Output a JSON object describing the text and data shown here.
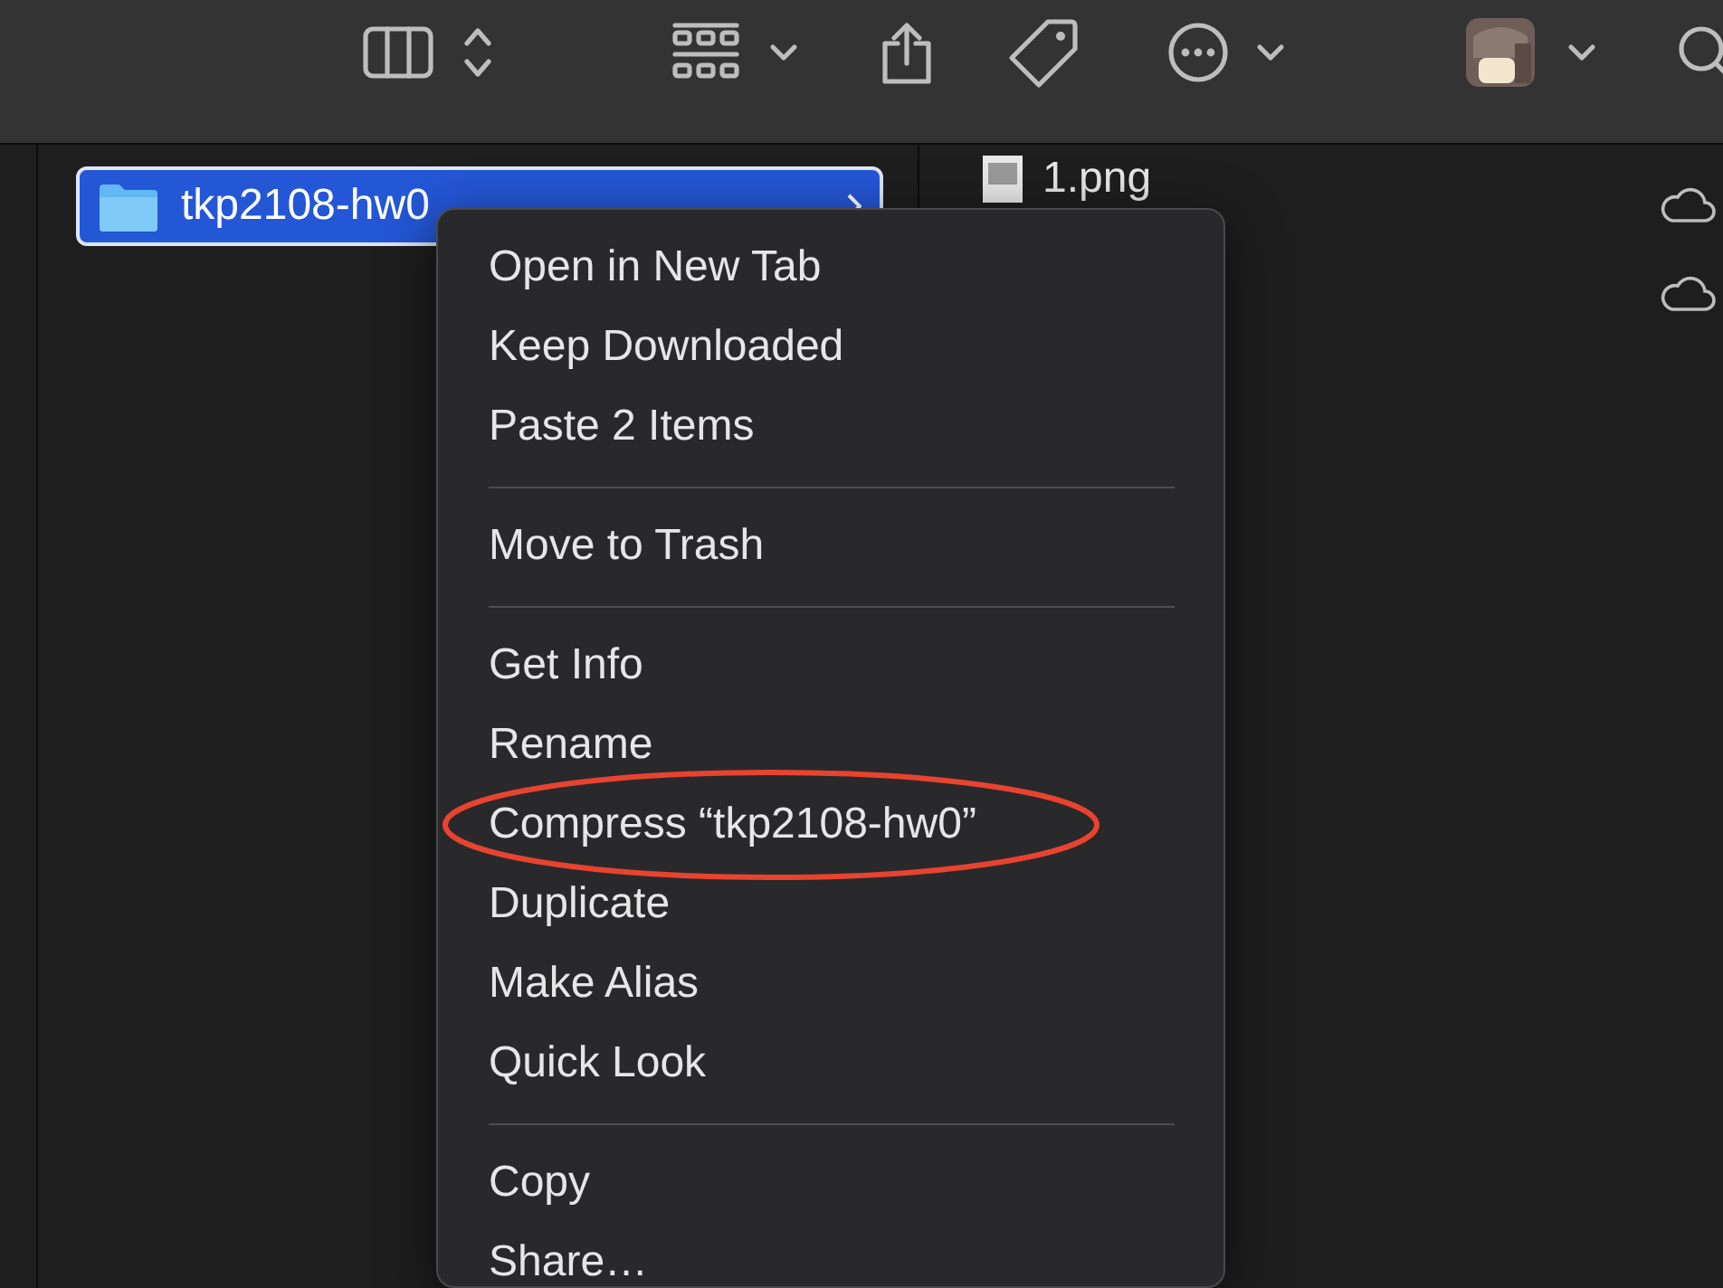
{
  "toolbar": {
    "buttons": [
      {
        "kind": "columns"
      },
      {
        "kind": "updown"
      },
      {
        "kind": "grid"
      },
      {
        "kind": "chevron"
      },
      {
        "kind": "share"
      },
      {
        "kind": "tag"
      },
      {
        "kind": "more"
      },
      {
        "kind": "chevron"
      },
      {
        "kind": "avatar"
      },
      {
        "kind": "chevron"
      },
      {
        "kind": "search"
      }
    ]
  },
  "folder": {
    "name": "tkp2108-hw0",
    "selected": true
  },
  "files": [
    {
      "name": "1.png"
    }
  ],
  "context_menu": {
    "items": [
      {
        "kind": "item",
        "label": "Open in New Tab",
        "circled": false
      },
      {
        "kind": "item",
        "label": "Keep Downloaded",
        "circled": false
      },
      {
        "kind": "item",
        "label": "Paste 2 Items",
        "circled": false
      },
      {
        "kind": "separator"
      },
      {
        "kind": "item",
        "label": "Move to Trash",
        "circled": false
      },
      {
        "kind": "separator"
      },
      {
        "kind": "item",
        "label": "Get Info",
        "circled": false
      },
      {
        "kind": "item",
        "label": "Rename",
        "circled": false
      },
      {
        "kind": "item",
        "label": "Compress “tkp2108-hw0”",
        "circled": true
      },
      {
        "kind": "item",
        "label": "Duplicate",
        "circled": false
      },
      {
        "kind": "item",
        "label": "Make Alias",
        "circled": false
      },
      {
        "kind": "item",
        "label": "Quick Look",
        "circled": false
      },
      {
        "kind": "separator"
      },
      {
        "kind": "item",
        "label": "Copy",
        "circled": false
      },
      {
        "kind": "item",
        "label": "Share…",
        "circled": false
      }
    ]
  }
}
